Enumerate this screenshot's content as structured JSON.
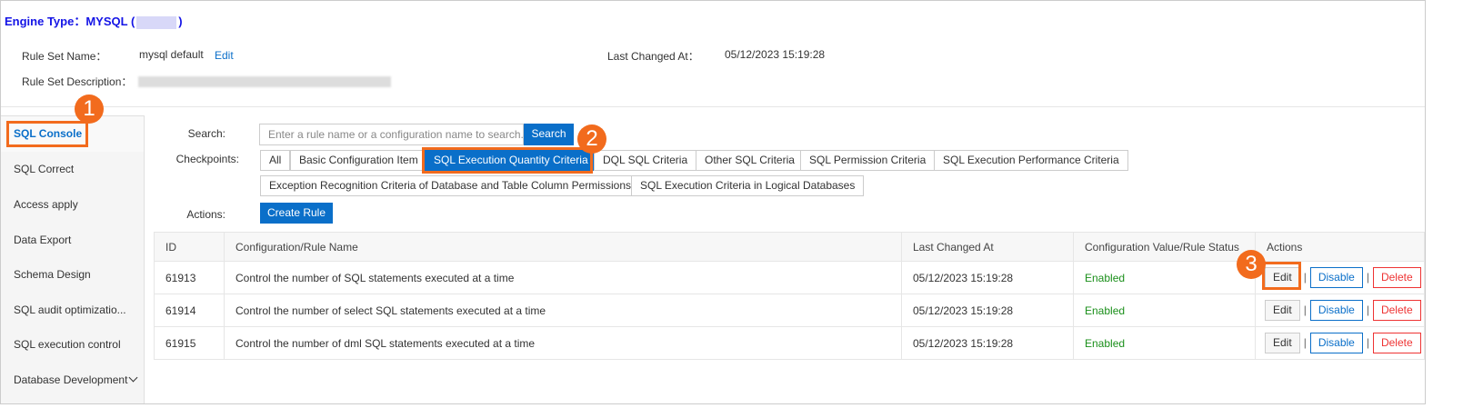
{
  "header": {
    "engine_label": "Engine Type：",
    "engine_value": "MYSQL",
    "paren_open": "(",
    "paren_close": ")",
    "rule_set_name_label": "Rule Set Name：",
    "rule_set_name": "mysql default",
    "edit_link": "Edit",
    "last_changed_label": "Last Changed At：",
    "last_changed_value": "05/12/2023 15:19:28",
    "description_label": "Rule Set Description："
  },
  "sidebar": {
    "items": [
      {
        "label": "SQL Console"
      },
      {
        "label": "SQL Correct"
      },
      {
        "label": "Access apply"
      },
      {
        "label": "Data Export"
      },
      {
        "label": "Schema Design"
      },
      {
        "label": "SQL audit optimizatio..."
      },
      {
        "label": "SQL execution control"
      },
      {
        "label": "Database Development"
      }
    ]
  },
  "filters": {
    "search_label": "Search:",
    "search_placeholder": "Enter a rule name or a configuration name to search.",
    "search_button": "Search",
    "checkpoints_label": "Checkpoints:",
    "checkpoints": [
      "All",
      "Basic Configuration Item",
      "SQL Execution Quantity Criteria",
      "DQL SQL Criteria",
      "Other SQL Criteria",
      "SQL Permission Criteria",
      "SQL Execution Performance Criteria",
      "Exception Recognition Criteria of Database and Table Column Permissions",
      "SQL Execution Criteria in Logical Databases"
    ],
    "selected_checkpoint": "SQL Execution Quantity Criteria",
    "actions_label": "Actions:",
    "create_rule": "Create Rule"
  },
  "table": {
    "headers": [
      "ID",
      "Configuration/Rule Name",
      "Last Changed At",
      "Configuration Value/Rule Status",
      "Actions"
    ],
    "rows": [
      {
        "id": "61913",
        "name": "Control the number of SQL statements executed at a time",
        "changed": "05/12/2023 15:19:28",
        "status": "Enabled"
      },
      {
        "id": "61914",
        "name": "Control the number of select SQL statements executed at a time",
        "changed": "05/12/2023 15:19:28",
        "status": "Enabled"
      },
      {
        "id": "61915",
        "name": "Control the number of dml SQL statements executed at a time",
        "changed": "05/12/2023 15:19:28",
        "status": "Enabled"
      }
    ],
    "action_labels": {
      "edit": "Edit",
      "sep": "|",
      "disable": "Disable",
      "delete": "Delete"
    }
  },
  "callouts": [
    "1",
    "2",
    "3"
  ],
  "colors": {
    "accent": "#0a6fc9",
    "callout": "#f26b1d",
    "enabled": "#1a8f1a",
    "delete": "#e33333"
  }
}
